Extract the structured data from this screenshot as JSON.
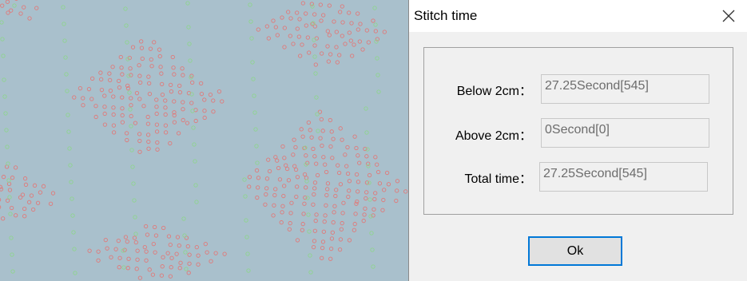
{
  "dialog": {
    "title": "Stitch time",
    "fields": [
      {
        "label": "Below 2cm：",
        "value": "27.25Second[545]"
      },
      {
        "label": "Above 2cm：",
        "value": "0Second[0]"
      },
      {
        "label": "Total time：",
        "value": "27.25Second[545]"
      }
    ],
    "ok_label": "Ok"
  },
  "colors": {
    "canvas_background": "#a9c0cc",
    "red_stitch": "#e07a7a",
    "green_stitch": "#8fd48f",
    "button_focus_border": "#0078d7"
  },
  "icons": {
    "close": "close-icon"
  }
}
